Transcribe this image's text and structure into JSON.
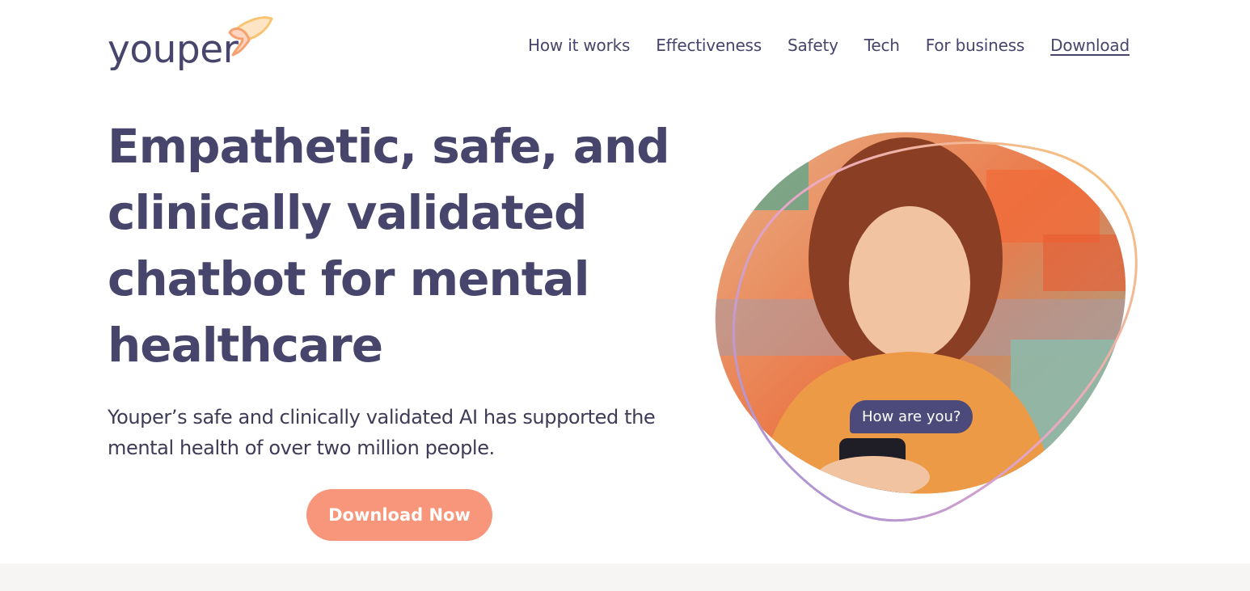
{
  "brand": {
    "logo_text": "youper",
    "colors": {
      "primary": "#47456b",
      "accent": "#f7967a",
      "bubble": "#4b4a7a",
      "logo_orange": "#f5a170",
      "logo_yellow": "#f8c471"
    }
  },
  "nav": {
    "items": [
      {
        "label": "How it works"
      },
      {
        "label": "Effectiveness"
      },
      {
        "label": "Safety"
      },
      {
        "label": "Tech"
      },
      {
        "label": "For business"
      },
      {
        "label": "Download",
        "active": true
      }
    ]
  },
  "hero": {
    "title": "Empathetic, safe, and clinically validated chatbot for mental healthcare",
    "subtitle": "Youper’s safe and clinically validated AI has supported the mental health of over two million people.",
    "cta_label": "Download Now",
    "chat_bubble": "How are you?",
    "image_icon": "woman-using-phone-photo"
  }
}
